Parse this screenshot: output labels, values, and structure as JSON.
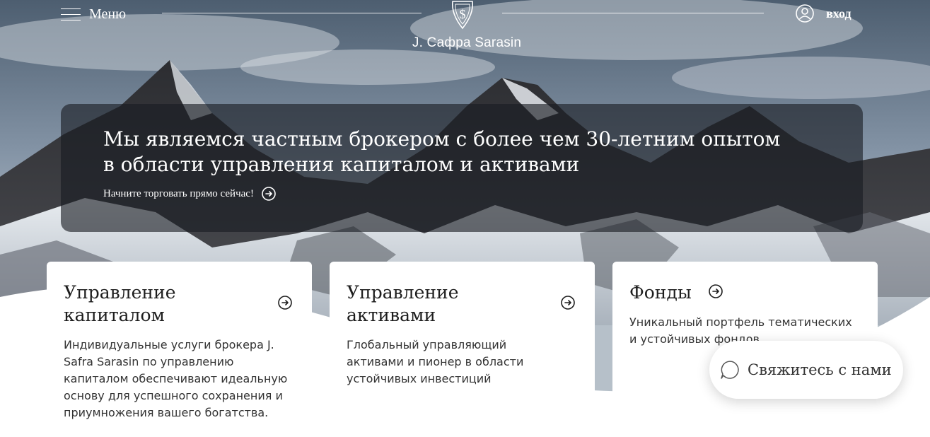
{
  "header": {
    "menu_label": "Меню",
    "brand_text": "J. Сафра Sarasin",
    "login_label": "вход"
  },
  "hero": {
    "title": "Мы являемся частным брокером с более чем 30-летним опытом в области управления капиталом и активами",
    "cta_label": "Начните торговать прямо сейчас!"
  },
  "cards": [
    {
      "title": "Управление капиталом",
      "description": "Индивидуальные услуги брокера J. Safra Sarasin по управлению капиталом обеспечивают идеальную основу для успешного сохранения и приумножения вашего богатства."
    },
    {
      "title": "Управление активами",
      "description": "Глобальный управляющий активами и пионер в области устойчивых инвестиций"
    },
    {
      "title": "Фонды",
      "description": "Уникальный портфель тематических и устойчивых фондов"
    }
  ],
  "contact": {
    "label": "Свяжитесь с нами"
  },
  "colors": {
    "text_dark": "#1d1d1d",
    "banner_overlay": "#191c22",
    "card_background": "#ffffff"
  },
  "icons": {
    "menu": "hamburger-icon",
    "logo": "shield-emblem-icon",
    "login": "user-circle-icon",
    "arrow": "arrow-right-circle-icon",
    "chat": "chat-bubble-icon"
  }
}
